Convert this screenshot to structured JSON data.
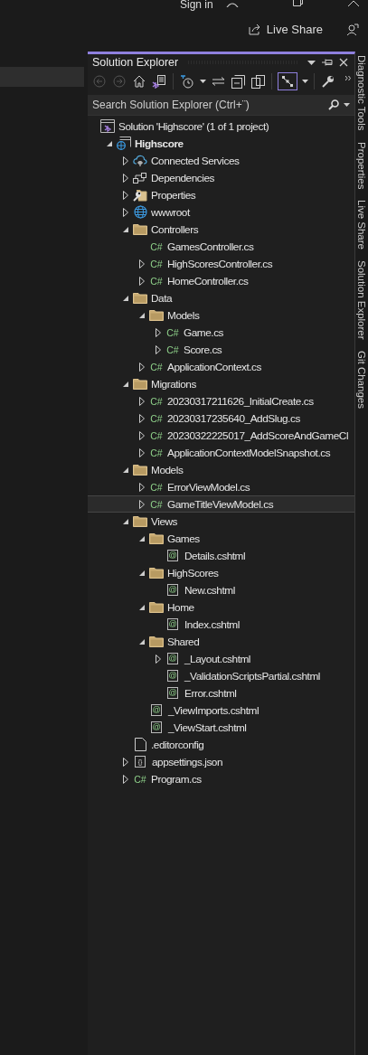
{
  "titlebar": {
    "sign_in": "Sign in",
    "live_share": "Live Share"
  },
  "panel": {
    "title": "Solution Explorer",
    "toolbar": [
      {
        "kind": "back",
        "disabled": true
      },
      {
        "kind": "forward",
        "disabled": true
      },
      {
        "kind": "home",
        "disabled": false
      },
      {
        "kind": "switch",
        "disabled": false
      },
      {
        "kind": "history",
        "disabled": false
      },
      {
        "kind": "caret",
        "disabled": false
      },
      {
        "kind": "sync",
        "disabled": false
      },
      {
        "kind": "collapse",
        "disabled": false
      },
      {
        "kind": "copies",
        "disabled": false
      },
      {
        "kind": "preview",
        "disabled": false,
        "selected": true
      },
      {
        "kind": "caret",
        "disabled": false
      },
      {
        "kind": "wrench",
        "disabled": false
      }
    ],
    "search": {
      "placeholder": "Search Solution Explorer (Ctrl+¨)"
    },
    "tree": [
      {
        "label": "Solution 'Highscore' (1 of 1 project)",
        "kind": "solution",
        "expandable": false,
        "selected": false,
        "children": [
          {
            "label": "Highscore",
            "kind": "project",
            "expandable": true,
            "expanded": true,
            "selected": false,
            "bold": true,
            "children": [
              {
                "label": "Connected Services",
                "kind": "cloud",
                "expandable": true,
                "expanded": false,
                "selected": false
              },
              {
                "label": "Dependencies",
                "kind": "deps",
                "expandable": true,
                "expanded": false,
                "selected": false
              },
              {
                "label": "Properties",
                "kind": "props",
                "expandable": true,
                "expanded": false,
                "selected": false
              },
              {
                "label": "wwwroot",
                "kind": "globe",
                "expandable": true,
                "expanded": false,
                "selected": false
              },
              {
                "label": "Controllers",
                "kind": "folder",
                "expandable": true,
                "expanded": true,
                "selected": false,
                "children": [
                  {
                    "label": "GamesController.cs",
                    "kind": "cs",
                    "badge": "C#",
                    "expandable": false,
                    "selected": false
                  },
                  {
                    "label": "HighScoresController.cs",
                    "kind": "cs",
                    "badge": "C#",
                    "expandable": true,
                    "expanded": false,
                    "selected": false
                  },
                  {
                    "label": "HomeController.cs",
                    "kind": "cs",
                    "badge": "C#",
                    "expandable": true,
                    "expanded": false,
                    "selected": false
                  }
                ]
              },
              {
                "label": "Data",
                "kind": "folder",
                "expandable": true,
                "expanded": true,
                "selected": false,
                "children": [
                  {
                    "label": "Models",
                    "kind": "folder",
                    "expandable": true,
                    "expanded": true,
                    "selected": false,
                    "children": [
                      {
                        "label": "Game.cs",
                        "kind": "cs",
                        "badge": "C#",
                        "expandable": true,
                        "expanded": false,
                        "selected": false
                      },
                      {
                        "label": "Score.cs",
                        "kind": "cs",
                        "badge": "C#",
                        "expandable": true,
                        "expanded": false,
                        "selected": false
                      }
                    ]
                  },
                  {
                    "label": "ApplicationContext.cs",
                    "kind": "cs",
                    "badge": "C#",
                    "expandable": true,
                    "expanded": false,
                    "selected": false
                  }
                ]
              },
              {
                "label": "Migrations",
                "kind": "folder",
                "expandable": true,
                "expanded": true,
                "selected": false,
                "children": [
                  {
                    "label": "20230317211626_InitialCreate.cs",
                    "kind": "cs",
                    "badge": "C#",
                    "expandable": true,
                    "expanded": false,
                    "selected": false
                  },
                  {
                    "label": "20230317235640_AddSlug.cs",
                    "kind": "cs",
                    "badge": "C#",
                    "expandable": true,
                    "expanded": false,
                    "selected": false
                  },
                  {
                    "label": "20230322225017_AddScoreAndGameCl",
                    "kind": "cs",
                    "badge": "C#",
                    "expandable": true,
                    "expanded": false,
                    "selected": false
                  },
                  {
                    "label": "ApplicationContextModelSnapshot.cs",
                    "kind": "cs",
                    "badge": "C#",
                    "expandable": true,
                    "expanded": false,
                    "selected": false
                  }
                ]
              },
              {
                "label": "Models",
                "kind": "folder",
                "expandable": true,
                "expanded": true,
                "selected": false,
                "children": [
                  {
                    "label": "ErrorViewModel.cs",
                    "kind": "cs",
                    "badge": "C#",
                    "expandable": true,
                    "expanded": false,
                    "selected": false
                  },
                  {
                    "label": "GameTitleViewModel.cs",
                    "kind": "cs",
                    "badge": "C#",
                    "expandable": true,
                    "expanded": false,
                    "selected": true
                  }
                ]
              },
              {
                "label": "Views",
                "kind": "folder",
                "expandable": true,
                "expanded": true,
                "selected": false,
                "children": [
                  {
                    "label": "Games",
                    "kind": "folder",
                    "expandable": true,
                    "expanded": true,
                    "selected": false,
                    "children": [
                      {
                        "label": "Details.cshtml",
                        "kind": "razor",
                        "badge": "@",
                        "expandable": false,
                        "selected": false
                      }
                    ]
                  },
                  {
                    "label": "HighScores",
                    "kind": "folder",
                    "expandable": true,
                    "expanded": true,
                    "selected": false,
                    "children": [
                      {
                        "label": "New.cshtml",
                        "kind": "razor",
                        "badge": "@",
                        "expandable": false,
                        "selected": false
                      }
                    ]
                  },
                  {
                    "label": "Home",
                    "kind": "folder",
                    "expandable": true,
                    "expanded": true,
                    "selected": false,
                    "children": [
                      {
                        "label": "Index.cshtml",
                        "kind": "razor",
                        "badge": "@",
                        "expandable": false,
                        "selected": false
                      }
                    ]
                  },
                  {
                    "label": "Shared",
                    "kind": "folder",
                    "expandable": true,
                    "expanded": true,
                    "selected": false,
                    "children": [
                      {
                        "label": "_Layout.cshtml",
                        "kind": "razor",
                        "badge": "@",
                        "expandable": true,
                        "expanded": false,
                        "selected": false
                      },
                      {
                        "label": "_ValidationScriptsPartial.cshtml",
                        "kind": "razor",
                        "badge": "@",
                        "expandable": false,
                        "selected": false
                      },
                      {
                        "label": "Error.cshtml",
                        "kind": "razor",
                        "badge": "@",
                        "expandable": false,
                        "selected": false
                      }
                    ]
                  },
                  {
                    "label": "_ViewImports.cshtml",
                    "kind": "razor",
                    "badge": "@",
                    "expandable": false,
                    "selected": false
                  },
                  {
                    "label": "_ViewStart.cshtml",
                    "kind": "razor",
                    "badge": "@",
                    "expandable": false,
                    "selected": false
                  }
                ]
              },
              {
                "label": ".editorconfig",
                "kind": "file",
                "expandable": false,
                "selected": false
              },
              {
                "label": "appsettings.json",
                "kind": "json",
                "badge": "{}",
                "expandable": true,
                "expanded": false,
                "selected": false
              },
              {
                "label": "Program.cs",
                "kind": "cs",
                "badge": "C#",
                "expandable": true,
                "expanded": false,
                "selected": false
              }
            ]
          }
        ]
      }
    ]
  },
  "side_tabs": [
    {
      "label": "Diagnostic Tools"
    },
    {
      "label": "Properties"
    },
    {
      "label": "Live Share"
    },
    {
      "label": "Solution Explorer"
    },
    {
      "label": "Git Changes"
    }
  ]
}
